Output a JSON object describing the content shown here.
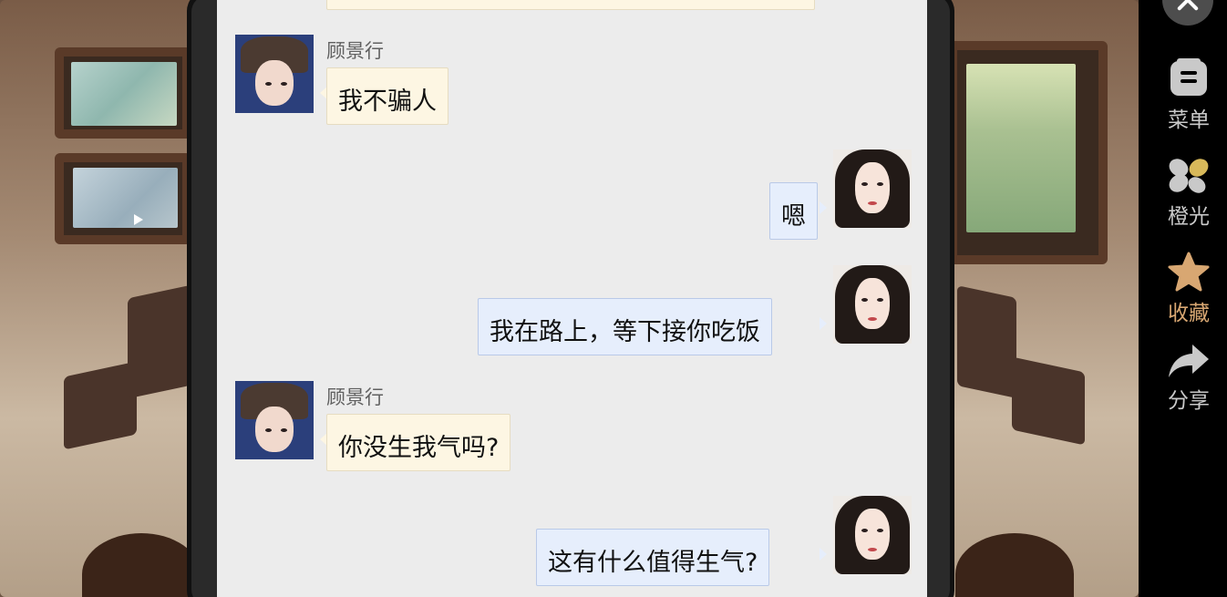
{
  "chat": {
    "messages": [
      {
        "side": "in",
        "sender": "顾景行",
        "text": "我不骗人"
      },
      {
        "side": "out",
        "text": "嗯"
      },
      {
        "side": "out",
        "text": "我在路上，等下接你吃饭"
      },
      {
        "side": "in",
        "sender": "顾景行",
        "text": "你没生我气吗?"
      },
      {
        "side": "out",
        "text": "这有什么值得生气?"
      }
    ]
  },
  "sidebar": {
    "items": [
      {
        "label": "菜单",
        "icon": "menu-icon"
      },
      {
        "label": "橙光",
        "icon": "orange-light-icon"
      },
      {
        "label": "收藏",
        "icon": "star-icon",
        "active": true
      },
      {
        "label": "分享",
        "icon": "share-icon"
      }
    ]
  },
  "colors": {
    "accent": "#d8a772",
    "incoming_bubble": "#fdf6e3",
    "outgoing_bubble": "#e6eefc",
    "chat_background": "#ececec"
  }
}
